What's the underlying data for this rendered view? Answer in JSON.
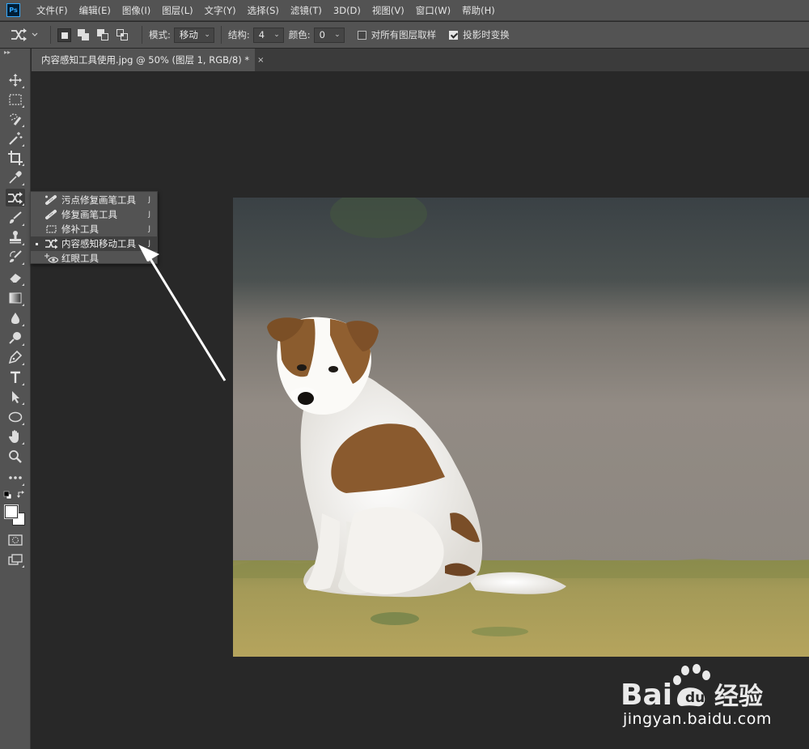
{
  "app": {
    "logo": "Ps"
  },
  "menu": [
    "文件(F)",
    "编辑(E)",
    "图像(I)",
    "图层(L)",
    "文字(Y)",
    "选择(S)",
    "滤镜(T)",
    "3D(D)",
    "视图(V)",
    "窗口(W)",
    "帮助(H)"
  ],
  "options": {
    "mode_label": "模式:",
    "mode_value": "移动",
    "structure_label": "结构:",
    "structure_value": "4",
    "color_label": "颜色:",
    "color_value": "0",
    "sample_all_label": "对所有图层取样",
    "sample_all_checked": false,
    "transform_label": "投影时变换",
    "transform_checked": true
  },
  "document": {
    "tab_title": "内容感知工具使用.jpg @ 50% (图层 1, RGB/8) *",
    "close_glyph": "×"
  },
  "flyout": {
    "items": [
      {
        "label": "污点修复画笔工具",
        "key": "J",
        "icon": "spot-healing-brush-icon",
        "selected": false
      },
      {
        "label": "修复画笔工具",
        "key": "J",
        "icon": "healing-brush-icon",
        "selected": false
      },
      {
        "label": "修补工具",
        "key": "J",
        "icon": "patch-icon",
        "selected": false
      },
      {
        "label": "内容感知移动工具",
        "key": "J",
        "icon": "content-aware-move-icon",
        "selected": true
      },
      {
        "label": "红眼工具",
        "key": "J",
        "icon": "red-eye-icon",
        "selected": false
      }
    ]
  },
  "toolbar": {
    "tools": [
      "move-icon",
      "marquee-icon",
      "quick-selection-icon",
      "magic-wand-icon",
      "crop-icon",
      "eyedropper-icon",
      "content-aware-move-icon",
      "brush-icon",
      "clone-stamp-icon",
      "history-brush-icon",
      "eraser-icon",
      "gradient-icon",
      "blur-icon",
      "dodge-icon",
      "pen-icon",
      "type-icon",
      "path-selection-icon",
      "ellipse-icon",
      "hand-icon",
      "zoom-icon",
      "more-tools-icon",
      "default-colors-icon",
      "foreground-background-icon",
      "quick-mask-icon",
      "screen-mode-icon"
    ]
  },
  "watermark": {
    "brand": "Bai",
    "brand_cn": "经验",
    "url": "jingyan.baidu.com"
  },
  "colors": {
    "panel": "#535353",
    "canvas": "#282828",
    "accent": "#31a8ff"
  }
}
